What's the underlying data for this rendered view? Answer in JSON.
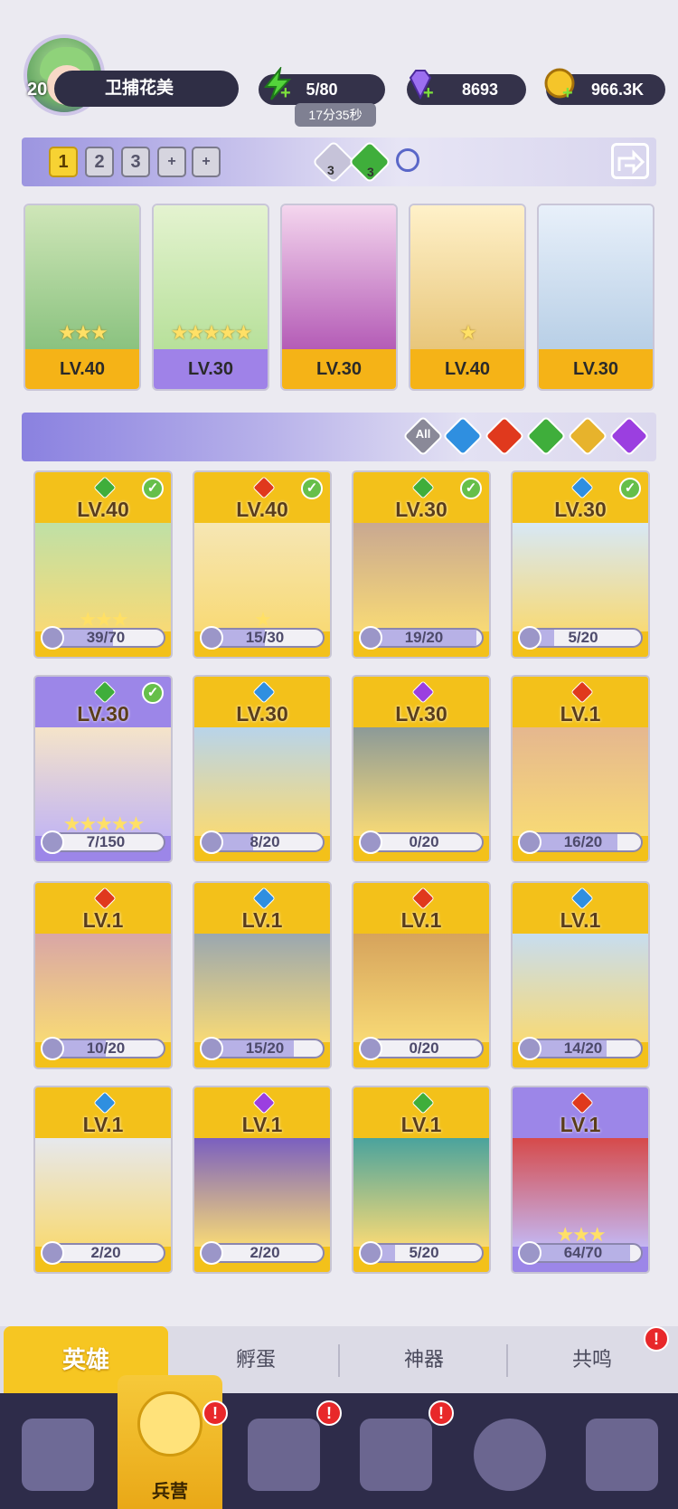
{
  "player": {
    "level": "20",
    "name": "卫捕花美"
  },
  "resources": {
    "energy": "5/80",
    "energy_timer": "17分35秒",
    "gems": "8693",
    "gold": "966.3K"
  },
  "team_bar": {
    "slots": [
      "1",
      "2",
      "3",
      "+",
      "+"
    ],
    "badges": [
      "3",
      "3"
    ]
  },
  "team_heroes": [
    {
      "level": "LV.40",
      "stars": "★★★",
      "element": "wind",
      "color": "#3fae3b"
    },
    {
      "level": "LV.30",
      "stars": "★★★★★",
      "element": "wind",
      "color": "#3fae3b"
    },
    {
      "level": "LV.30",
      "stars": "",
      "element": "wind",
      "color": "#3fae3b"
    },
    {
      "level": "LV.40",
      "stars": "★",
      "element": "fire",
      "color": "#e0391d"
    },
    {
      "level": "LV.30",
      "stars": "",
      "element": "water",
      "color": "#2f8fe0"
    }
  ],
  "filters": {
    "all_label": "All"
  },
  "heroes": [
    {
      "level": "LV.40",
      "progress": "39/70",
      "fill": 0.56,
      "element_color": "#3fae3b",
      "checked": true,
      "stars": "★★★",
      "frame": "gold"
    },
    {
      "level": "LV.40",
      "progress": "15/30",
      "fill": 0.5,
      "element_color": "#e0391d",
      "checked": true,
      "stars": "★",
      "frame": "gold"
    },
    {
      "level": "LV.30",
      "progress": "19/20",
      "fill": 0.95,
      "element_color": "#3fae3b",
      "checked": true,
      "stars": "",
      "frame": "gold"
    },
    {
      "level": "LV.30",
      "progress": "5/20",
      "fill": 0.25,
      "element_color": "#2f8fe0",
      "checked": true,
      "stars": "",
      "frame": "gold"
    },
    {
      "level": "LV.30",
      "progress": "7/150",
      "fill": 0.05,
      "element_color": "#3fae3b",
      "checked": true,
      "stars": "★★★★★",
      "frame": "purple"
    },
    {
      "level": "LV.30",
      "progress": "8/20",
      "fill": 0.4,
      "element_color": "#2f8fe0",
      "checked": false,
      "stars": "",
      "frame": "gold"
    },
    {
      "level": "LV.30",
      "progress": "0/20",
      "fill": 0,
      "element_color": "#9b3fe0",
      "checked": false,
      "stars": "",
      "frame": "gold"
    },
    {
      "level": "LV.1",
      "progress": "16/20",
      "fill": 0.8,
      "element_color": "#e0391d",
      "checked": false,
      "stars": "",
      "frame": "gold"
    },
    {
      "level": "LV.1",
      "progress": "10/20",
      "fill": 0.5,
      "element_color": "#e0391d",
      "checked": false,
      "stars": "",
      "frame": "gold"
    },
    {
      "level": "LV.1",
      "progress": "15/20",
      "fill": 0.75,
      "element_color": "#2f8fe0",
      "checked": false,
      "stars": "",
      "frame": "gold"
    },
    {
      "level": "LV.1",
      "progress": "0/20",
      "fill": 0,
      "element_color": "#e0391d",
      "checked": false,
      "stars": "",
      "frame": "gold"
    },
    {
      "level": "LV.1",
      "progress": "14/20",
      "fill": 0.7,
      "element_color": "#2f8fe0",
      "checked": false,
      "stars": "",
      "frame": "gold"
    },
    {
      "level": "LV.1",
      "progress": "2/20",
      "fill": 0.1,
      "element_color": "#2f8fe0",
      "checked": false,
      "stars": "",
      "frame": "gold"
    },
    {
      "level": "LV.1",
      "progress": "2/20",
      "fill": 0.1,
      "element_color": "#9b3fe0",
      "checked": false,
      "stars": "",
      "frame": "gold"
    },
    {
      "level": "LV.1",
      "progress": "5/20",
      "fill": 0.25,
      "element_color": "#3fae3b",
      "checked": false,
      "stars": "",
      "frame": "gold"
    },
    {
      "level": "LV.1",
      "progress": "64/70",
      "fill": 0.91,
      "element_color": "#e0391d",
      "checked": false,
      "stars": "★★★",
      "frame": "purple"
    }
  ],
  "tabs": [
    "英雄",
    "孵蛋",
    "神器",
    "共鸣"
  ],
  "bottom_nav": {
    "active_label": "兵营"
  }
}
